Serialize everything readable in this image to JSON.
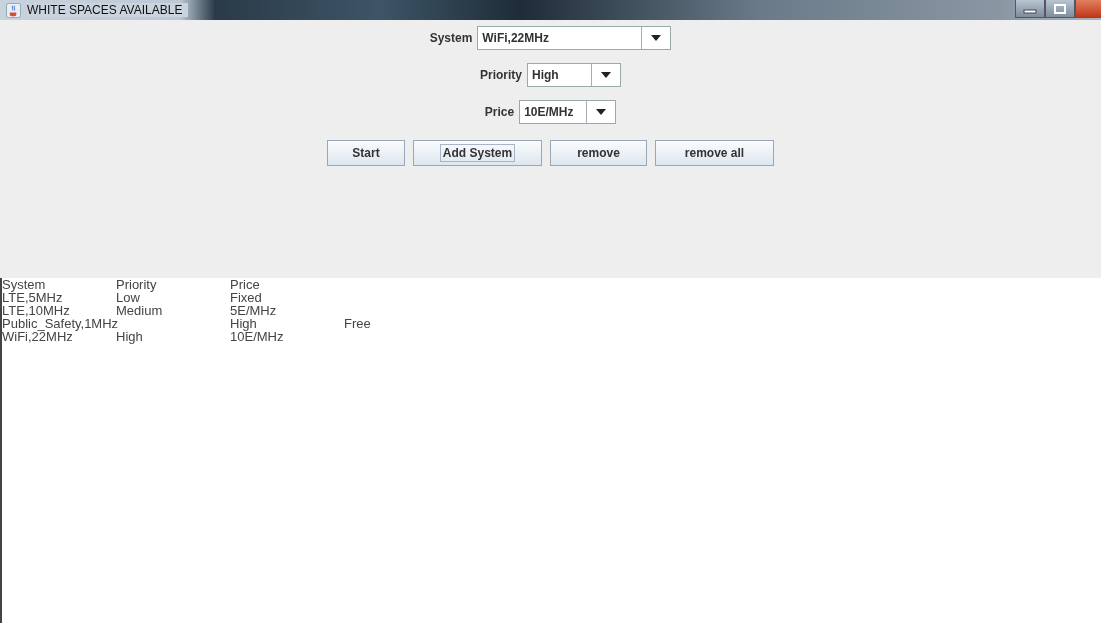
{
  "window": {
    "title": "WHITE SPACES AVAILABLE"
  },
  "fields": [
    {
      "label": "System",
      "value": "WiFi,22MHz"
    },
    {
      "label": "Priority",
      "value": "High"
    },
    {
      "label": "Price",
      "value": "10E/MHz"
    }
  ],
  "buttons": [
    {
      "label": "Start",
      "focused": false
    },
    {
      "label": "Add System",
      "focused": true
    },
    {
      "label": "remove",
      "focused": false
    },
    {
      "label": "remove all",
      "focused": false
    }
  ],
  "output_lines": [
    "System\tPriority\tPrice",
    "LTE,5MHz\tLow\tFixed",
    "LTE,10MHz\tMedium\t5E/MHz",
    "Public_Safety,1MHz\tHigh\tFree",
    "WiFi,22MHz\tHigh\t10E/MHz"
  ]
}
